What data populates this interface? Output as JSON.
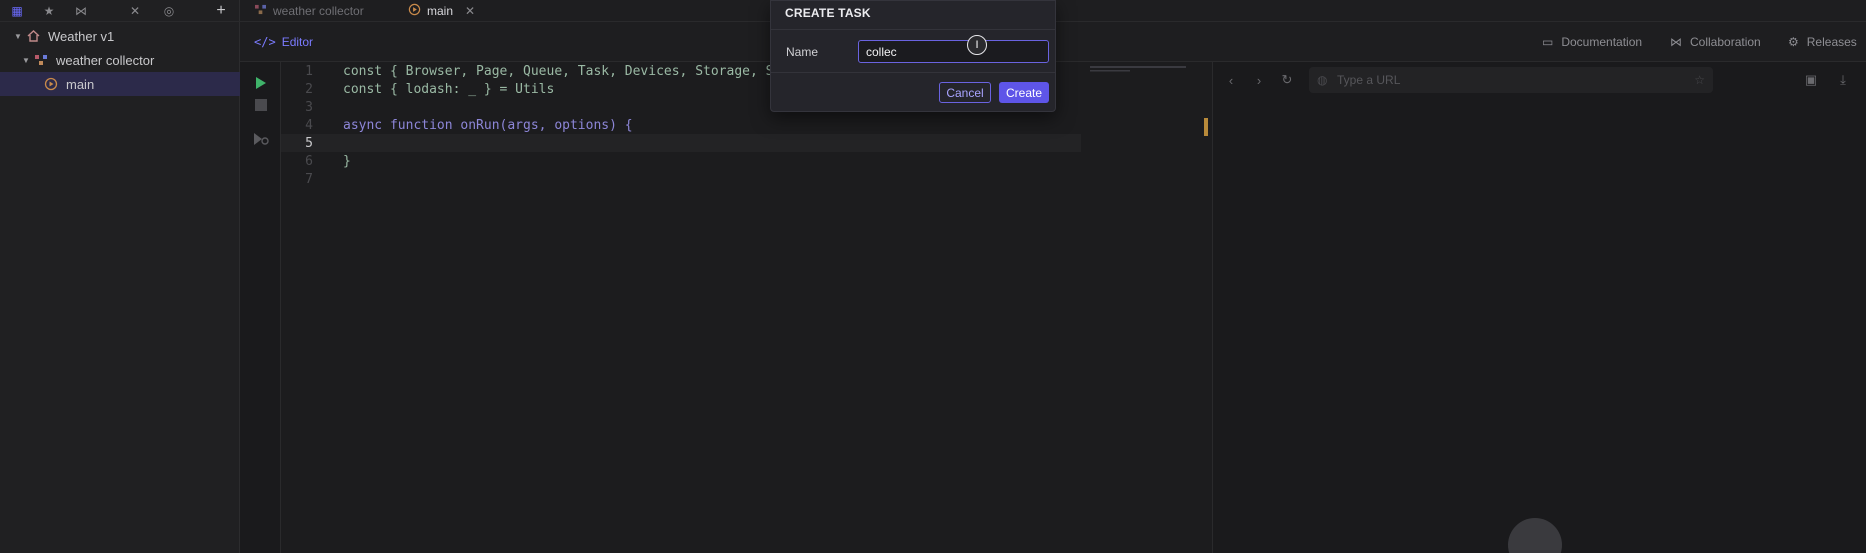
{
  "sidebar": {
    "tree": [
      {
        "label": "Weather v1",
        "icon": "home-icon"
      },
      {
        "label": "weather collector",
        "icon": "nodes-icon"
      },
      {
        "label": "main",
        "icon": "task-icon"
      }
    ]
  },
  "tabs": [
    {
      "label": "weather collector"
    },
    {
      "label": "main"
    }
  ],
  "subbar": {
    "editor": "Editor",
    "documentation": "Documentation",
    "collaboration": "Collaboration",
    "releases": "Releases"
  },
  "code": {
    "lines": [
      {
        "n": "1",
        "text": "const { Browser, Page, Queue, Task, Devices, Storage, S"
      },
      {
        "n": "2",
        "text": "const { lodash: _ } = Utils"
      },
      {
        "n": "3",
        "text": ""
      },
      {
        "n": "4",
        "text": "async function onRun(args, options) {"
      },
      {
        "n": "5",
        "text": ""
      },
      {
        "n": "6",
        "text": "}"
      },
      {
        "n": "7",
        "text": ""
      }
    ]
  },
  "browser": {
    "url_placeholder": "Type a URL"
  },
  "dialog": {
    "title": "CREATE TASK",
    "name_label": "Name",
    "name_value": "collec",
    "cancel": "Cancel",
    "create": "Create"
  },
  "colors": {
    "accent": "#5e55e8",
    "selection": "#2c2a4a"
  }
}
